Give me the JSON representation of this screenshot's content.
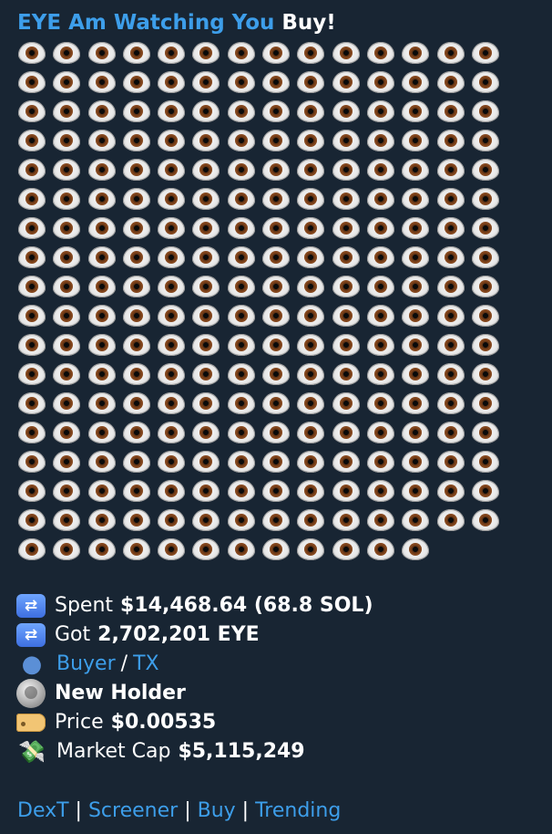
{
  "title": {
    "name_link": "EYE Am Watching You",
    "suffix": "Buy!"
  },
  "eye_grid": {
    "icon": "eye-emoji",
    "full_rows": 17,
    "per_row": 14,
    "last_row_count": 12
  },
  "stats": {
    "spent": {
      "icon": "shuffle-icon",
      "label": "Spent",
      "value": "$14,468.64 (68.8 SOL)"
    },
    "got": {
      "icon": "shuffle-icon",
      "label": "Got",
      "value": "2,702,201 EYE"
    },
    "buyer": {
      "icon": "person-silhouette-icon",
      "buyer_link": "Buyer",
      "separator": "/",
      "tx_link": "TX"
    },
    "holder": {
      "icon": "coin-icon",
      "value": "New Holder"
    },
    "price": {
      "icon": "price-tag-icon",
      "label": "Price",
      "value": "$0.00535"
    },
    "market_cap": {
      "icon": "money-with-wings-icon",
      "label": "Market Cap",
      "value": "$5,115,249"
    }
  },
  "links": {
    "items": [
      "DexT",
      "Screener",
      "Buy",
      "Trending"
    ],
    "separator": "|"
  },
  "colors": {
    "background": "#182533",
    "link": "#3d9eea",
    "text": "#ffffff"
  }
}
